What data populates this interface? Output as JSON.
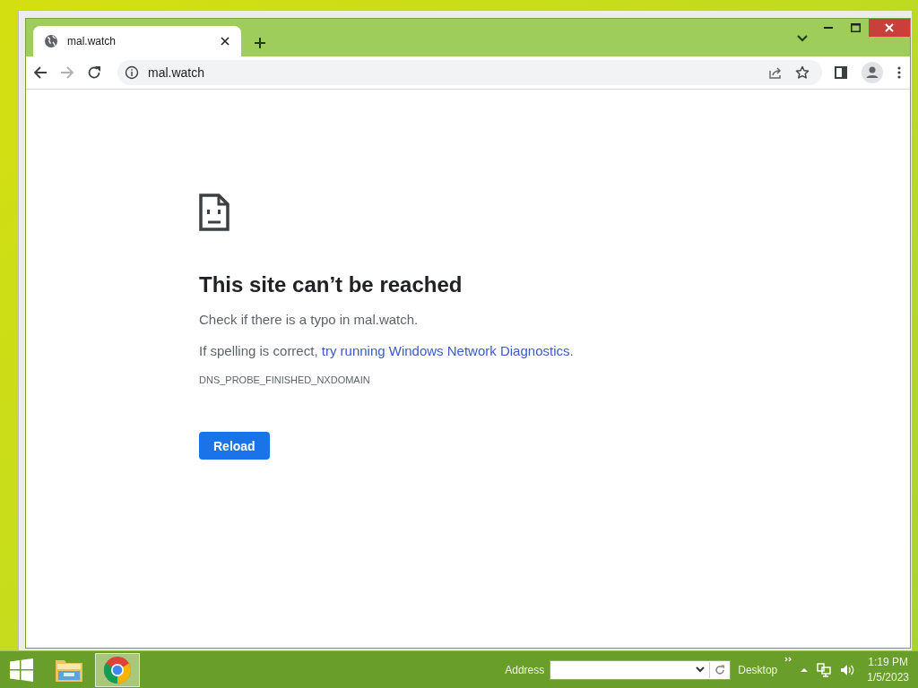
{
  "tab": {
    "title": "mal.watch",
    "selected": true
  },
  "address_bar": {
    "url": "mal.watch"
  },
  "error": {
    "heading": "This site can’t be reached",
    "line_1": "Check if there is a typo in mal.watch.",
    "line_2": {
      "prefix": "If spelling is correct, ",
      "link": "try running Windows Network Diagnostics",
      "suffix": "."
    },
    "code": "DNS_PROBE_FINISHED_NXDOMAIN",
    "button": "Reload"
  },
  "taskbar": {
    "apps": [
      {
        "kind": "explorer",
        "selected": false
      },
      {
        "kind": "chrome",
        "selected": true
      }
    ],
    "address_label": "Address",
    "toolbar_label": "Desktop",
    "time": "1:19 PM",
    "date": "1/5/2023"
  }
}
